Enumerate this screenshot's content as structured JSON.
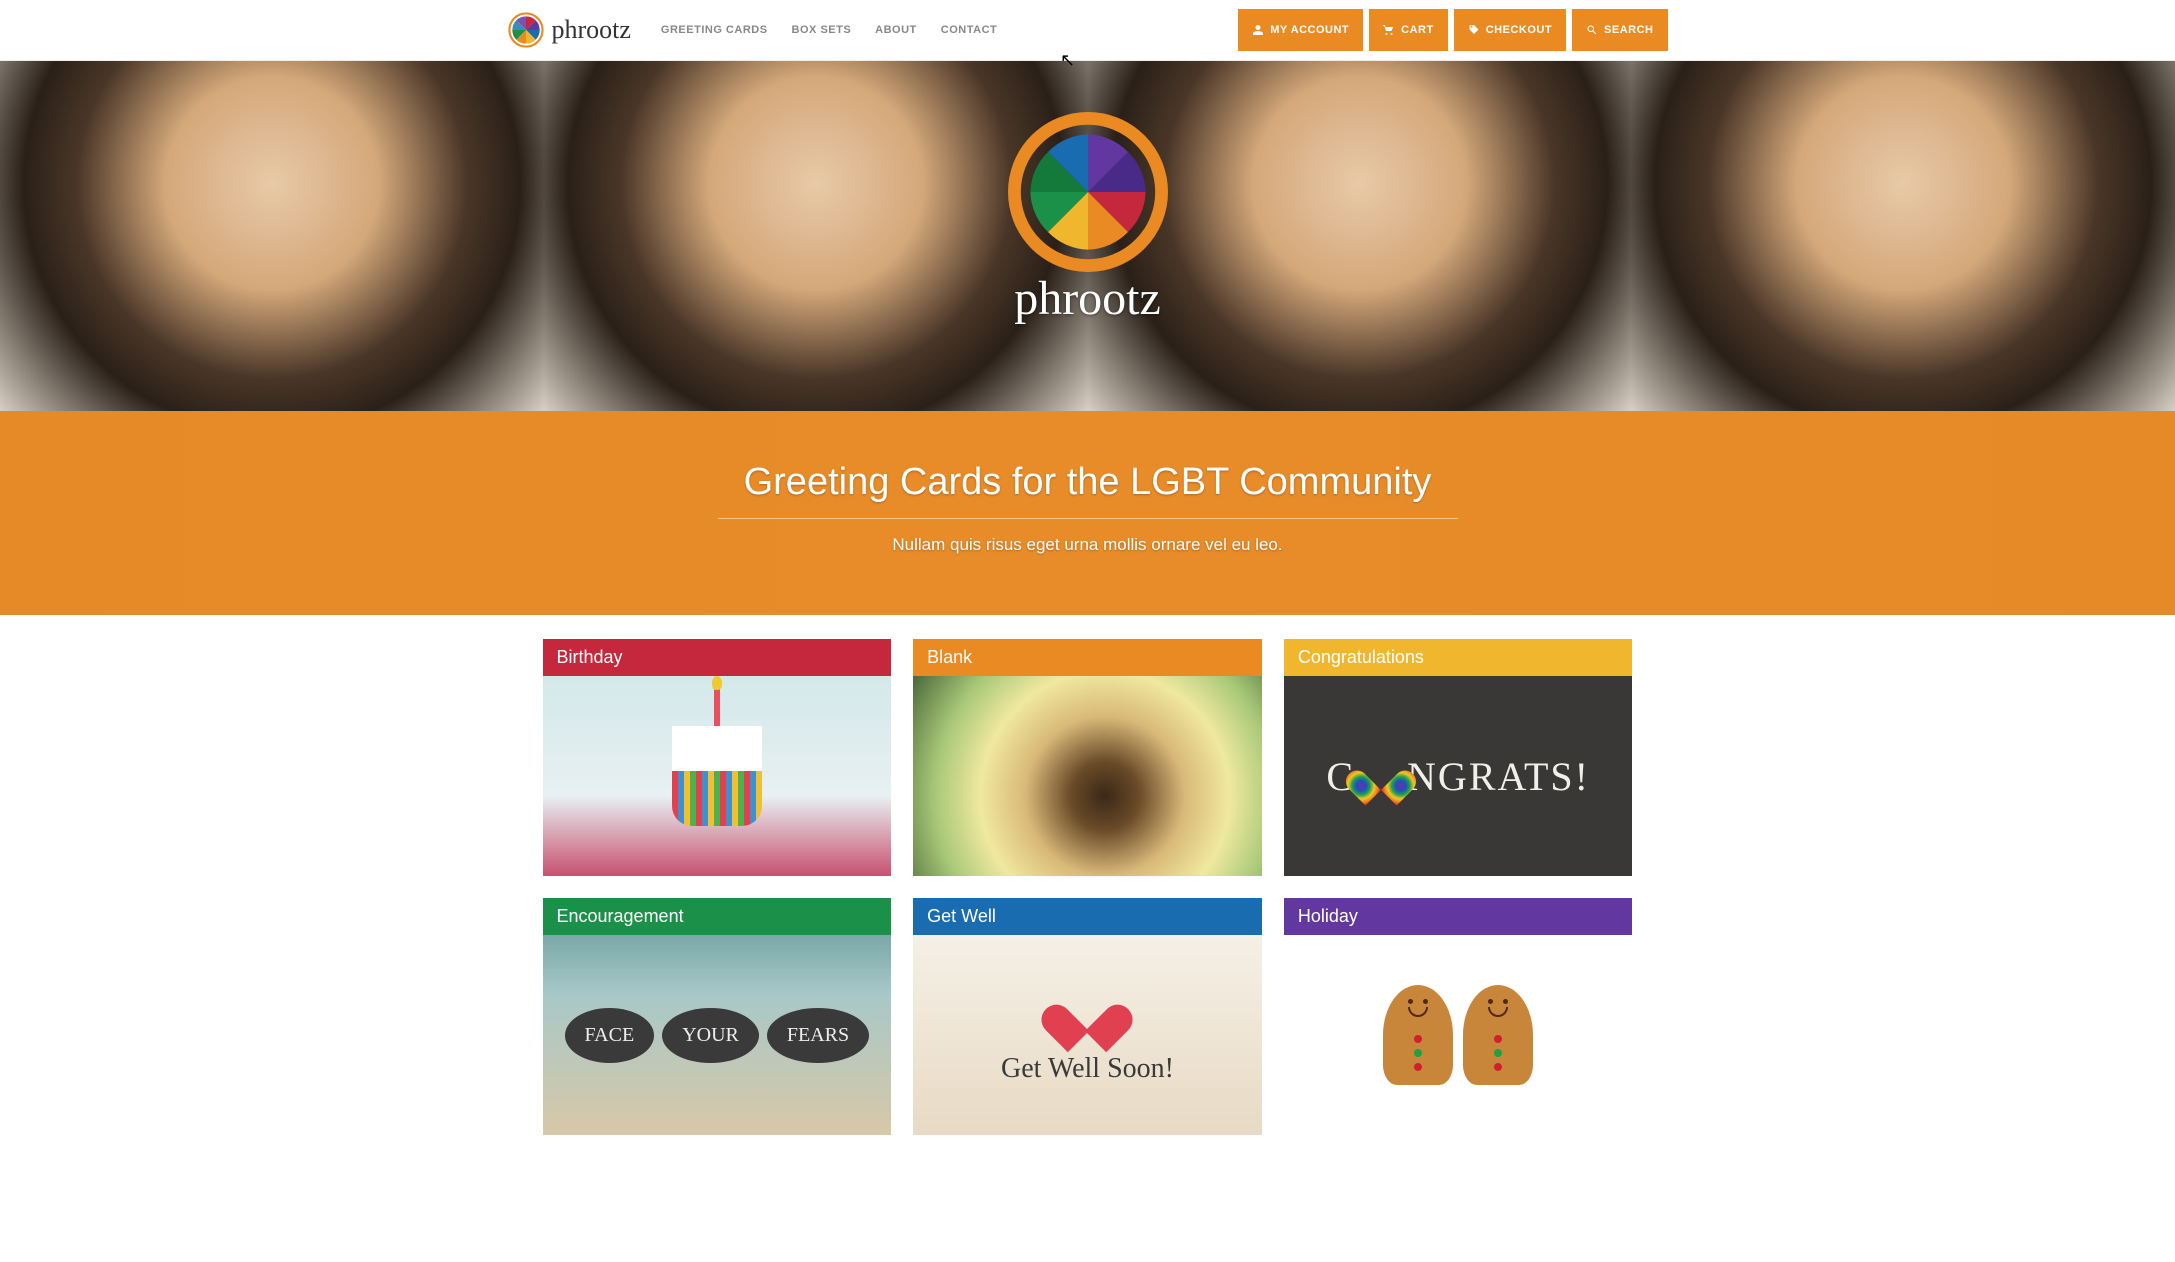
{
  "brand": "phrootz",
  "nav": {
    "links": [
      "GREETING CARDS",
      "BOX SETS",
      "ABOUT",
      "CONTACT"
    ],
    "buttons": {
      "account": "MY ACCOUNT",
      "cart": "CART",
      "checkout": "CHECKOUT",
      "search": "SEARCH"
    }
  },
  "hero": {
    "brand": "phrootz"
  },
  "banner": {
    "title": "Greeting Cards for the LGBT Community",
    "subtitle": "Nullam quis risus eget urna mollis ornare vel eu leo."
  },
  "categories": [
    {
      "label": "Birthday"
    },
    {
      "label": "Blank"
    },
    {
      "label": "Congratulations"
    },
    {
      "label": "Encouragement"
    },
    {
      "label": "Get Well"
    },
    {
      "label": "Holiday"
    }
  ],
  "congrats_text_parts": {
    "tail": "NGRATS!"
  },
  "encouragement_words": [
    "FACE",
    "YOUR",
    "FEARS"
  ],
  "getwell_text": "Get Well Soon!"
}
